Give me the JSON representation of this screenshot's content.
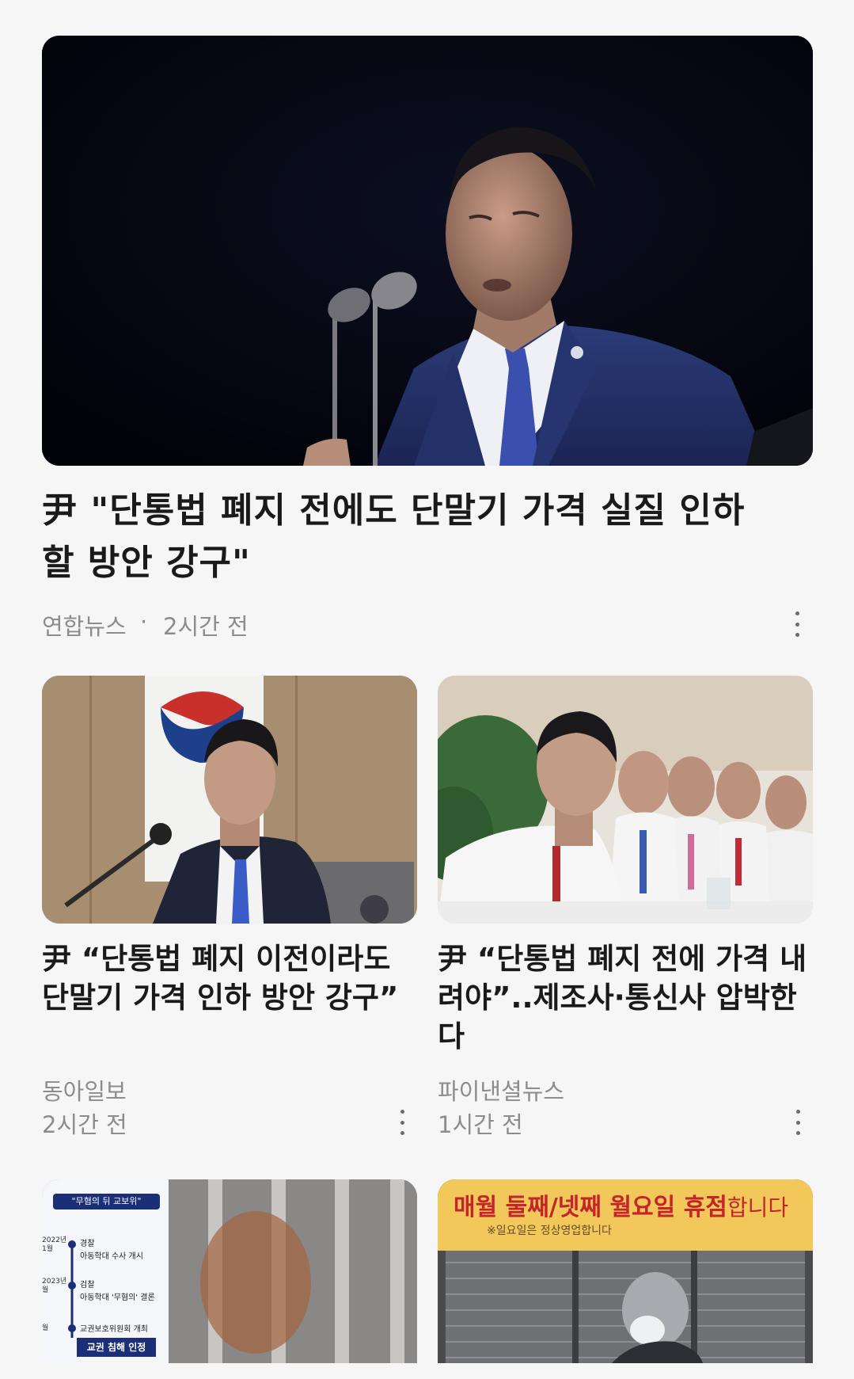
{
  "hero": {
    "title": "尹 \"단통법 폐지 전에도 단말기 가격 실질 인하할 방안 강구\"",
    "source": "연합뉴스",
    "separator": "·",
    "time": "2시간 전"
  },
  "cards": [
    {
      "title": "尹 “단통법 폐지 이전이라도 단말기 가격 인하 방안 강구”",
      "source": "동아일보",
      "time": "2시간 전"
    },
    {
      "title": "尹 “단통법 폐지 전에 가격 내려야”..제조사·통신사 압박한다",
      "source": "파이낸셜뉴스",
      "time": "1시간 전"
    }
  ],
  "bottom_cards": [
    {
      "graphic": {
        "header": "\"무혐의 뒤 교보위\"",
        "rows": [
          {
            "date": "2022년 1월",
            "title": "경찰",
            "desc": "아동학대 수사 개시"
          },
          {
            "date": "2023년 월",
            "title": "검찰",
            "desc": "아동학대 '무혐의' 결론"
          },
          {
            "date": "월",
            "title": "",
            "desc": "교권보호위원회 개최"
          }
        ],
        "badge": "교권 침해 인정"
      }
    },
    {
      "sign_main": "매월 둘째/넷째 월요일 휴점",
      "sign_suffix": "합니다",
      "sign_sub": "※일요일은 정상영업합니다"
    }
  ],
  "colors": {
    "background": "#f6f6f6",
    "title_text": "#1a1a1a",
    "meta_text": "#8c8c8c",
    "sign_red": "#c4242a",
    "sign_yellow": "#f2c85a"
  }
}
